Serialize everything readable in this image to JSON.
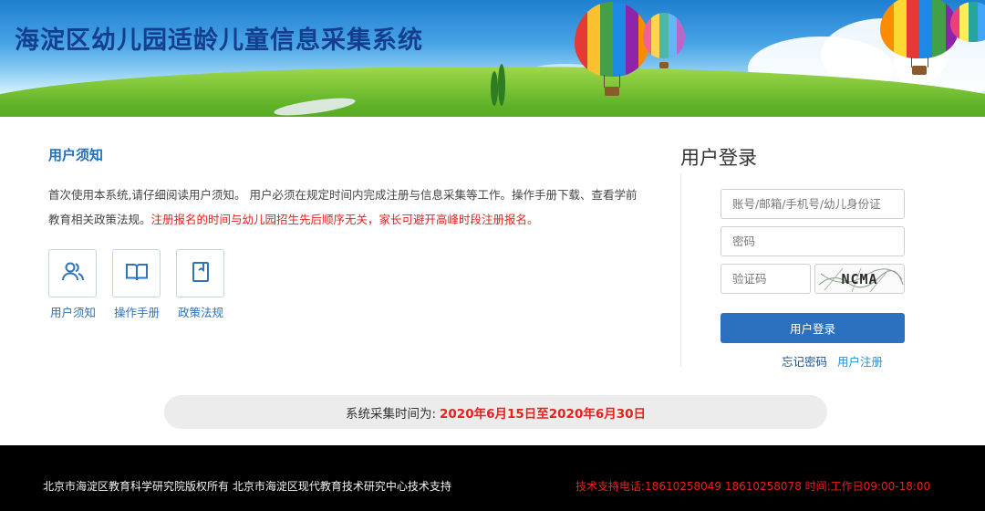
{
  "header": {
    "title": "海淀区幼儿园适龄儿童信息采集系统"
  },
  "notice": {
    "title": "用户须知",
    "text_normal": "首次使用本系统,请仔细阅读用户须知。 用户必须在规定时间内完成注册与信息采集等工作。操作手册下载、查看学前教育相关政策法规。",
    "text_red": "注册报名的时间与幼儿园招生先后顺序无关，家长可避开高峰时段注册报名。",
    "tiles": [
      {
        "label": "用户须知",
        "icon": "users-icon"
      },
      {
        "label": "操作手册",
        "icon": "book-icon"
      },
      {
        "label": "政策法规",
        "icon": "document-icon"
      }
    ]
  },
  "login": {
    "title": "用户登录",
    "account_placeholder": "账号/邮箱/手机号/幼儿身份证",
    "password_placeholder": "密码",
    "captcha_placeholder": "验证码",
    "captcha_text": "NCMA",
    "submit_label": "用户登录",
    "forgot_label": "忘记密码",
    "register_label": "用户注册",
    "colors": {
      "button": "#2b71bf",
      "link_dark": "#1f4f8f",
      "link_light": "#2a8fd6"
    }
  },
  "period": {
    "label": "系统采集时间为:",
    "value": "2020年6月15日至2020年6月30日"
  },
  "footer": {
    "copyright": "北京市海淀区教育科学研究院版权所有 北京市海淀区现代教育技术研究中心技术支持",
    "support": "技术支持电话:18610258049 18610258078 时间:工作日09:00-18:00"
  }
}
